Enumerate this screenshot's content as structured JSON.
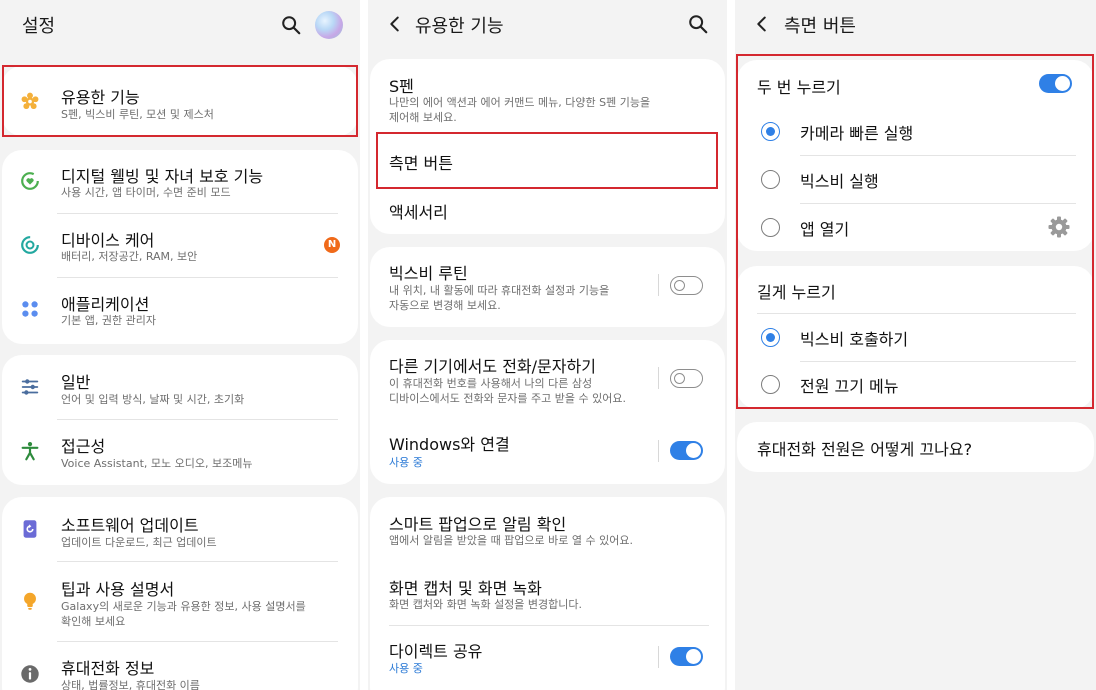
{
  "settings": {
    "header": {
      "title": "설정"
    },
    "groups": [
      {
        "items": [
          {
            "title": "유용한 기능",
            "subtitle": "S펜, 빅스비 루틴, 모션 및 제스처",
            "icon": "gear-flower-icon",
            "color": "#f4b03a"
          }
        ]
      },
      {
        "items": [
          {
            "title": "디지털 웰빙 및 자녀 보호 기능",
            "subtitle": "사용 시간, 앱 타이머, 수면 준비 모드",
            "icon": "digital-wellbeing-icon",
            "color": "#4caf50"
          },
          {
            "title": "디바이스 케어",
            "subtitle": "배터리, 저장공간, RAM, 보안",
            "icon": "device-care-icon",
            "color": "#23a8a0",
            "badge": "N"
          },
          {
            "title": "애플리케이션",
            "subtitle": "기본 앱, 권한 관리자",
            "icon": "apps-grid-icon",
            "color": "#5b8def"
          }
        ]
      },
      {
        "items": [
          {
            "title": "일반",
            "subtitle": "언어 및 입력 방식, 날짜 및 시간, 초기화",
            "icon": "sliders-icon",
            "color": "#4a6d9e"
          },
          {
            "title": "접근성",
            "subtitle": "Voice Assistant, 모노 오디오, 보조메뉴",
            "icon": "accessibility-icon",
            "color": "#2e8b3d"
          }
        ]
      },
      {
        "items": [
          {
            "title": "소프트웨어 업데이트",
            "subtitle": "업데이트 다운로드, 최근 업데이트",
            "icon": "software-update-icon",
            "color": "#6b6bd6"
          },
          {
            "title": "팁과 사용 설명서",
            "subtitle": "Galaxy의 새로운 기능과 유용한 정보, 사용 설명서를 확인해 보세요",
            "subtitle_lines": [
              "Galaxy의 새로운 기능과 유용한 정보, 사용 설명서를",
              "확인해 보세요"
            ],
            "icon": "lightbulb-icon",
            "color": "#f4a62a"
          },
          {
            "title": "휴대전화 정보",
            "subtitle": "상태, 법률정보, 휴대전화 이름",
            "icon": "info-icon",
            "color": "#6a6a6a"
          }
        ]
      }
    ]
  },
  "advanced": {
    "header": {
      "title": "유용한 기능"
    },
    "spen": {
      "title": "S펜",
      "subtitle_lines": [
        "나만의 에어 액션과 에어 커맨드 메뉴, 다양한 S펜 기능을",
        "제어해 보세요."
      ]
    },
    "side_key": {
      "title": "측면 버튼"
    },
    "accessories": {
      "title": "액세서리"
    },
    "bixby_routines": {
      "title": "빅스비 루틴",
      "subtitle_lines": [
        "내 위치, 내 활동에 따라 휴대전화 설정과 기능을",
        "자동으로 변경해 보세요."
      ],
      "toggle": false
    },
    "call_text": {
      "title": "다른 기기에서도 전화/문자하기",
      "subtitle_lines": [
        "이 휴대전화 번호를 사용해서 나의 다른 삼성",
        "디바이스에서도 전화와 문자를 주고 받을 수 있어요."
      ],
      "toggle": false
    },
    "windows": {
      "title": "Windows와 연결",
      "status": "사용 중",
      "toggle": true
    },
    "smart_popup": {
      "title": "스마트 팝업으로 알림 확인",
      "subtitle": "앱에서 알림을 받았을 때 팝업으로 바로 열 수 있어요."
    },
    "screenshots": {
      "title": "화면 캡처 및 화면 녹화",
      "subtitle": "화면 캡처와 화면 녹화 설정을 변경합니다."
    },
    "direct_share": {
      "title": "다이렉트 공유",
      "status": "사용 중",
      "toggle": true
    }
  },
  "side_key": {
    "header": {
      "title": "측면 버튼"
    },
    "double_press": {
      "title": "두 번 누르기",
      "toggle": true,
      "options": [
        {
          "label": "카메라 빠른 실행",
          "selected": true
        },
        {
          "label": "빅스비 실행",
          "selected": false
        },
        {
          "label": "앱 열기",
          "selected": false,
          "settings_icon": "gear-icon"
        }
      ]
    },
    "press_hold": {
      "title": "길게 누르기",
      "options": [
        {
          "label": "빅스비 호출하기",
          "selected": true
        },
        {
          "label": "전원 끄기 메뉴",
          "selected": false
        }
      ]
    },
    "faq": {
      "title": "휴대전화 전원은 어떻게 끄나요?"
    }
  },
  "colors": {
    "accent": "#2f80e6",
    "highlight": "#d4282f",
    "panel_bg": "#f3f3f3",
    "card_bg": "#ffffff"
  }
}
